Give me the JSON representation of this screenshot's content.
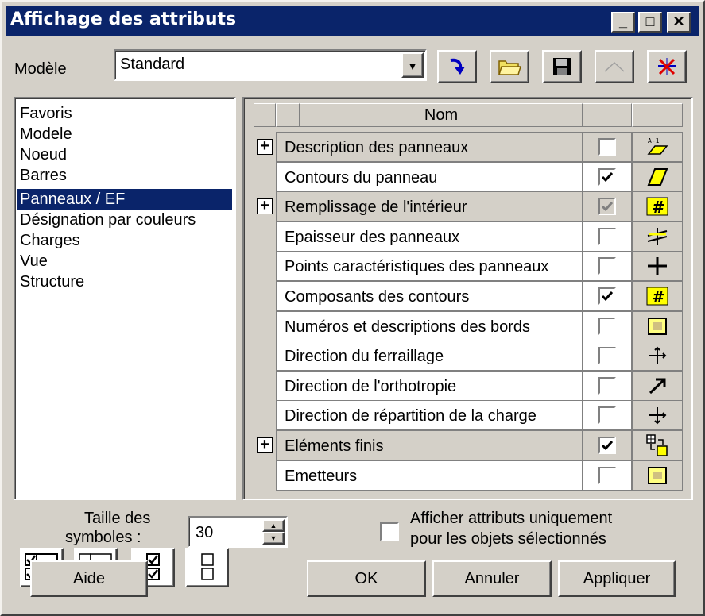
{
  "window": {
    "title": "Affichage des attributs"
  },
  "titlebar_buttons": {
    "minimize": "_",
    "maximize": "□",
    "close": "✕"
  },
  "model": {
    "label": "Modèle",
    "value": "Standard"
  },
  "toolbar": {
    "buttons": [
      "apply-arrow-icon",
      "open-folder-icon",
      "save-disk-icon",
      "disabled-chevron-icon",
      "delete-icon"
    ]
  },
  "categories": {
    "items": [
      "Favoris",
      "Modele",
      "Noeud",
      "Barres",
      "Panneaux / EF",
      "Désignation par couleurs",
      "Charges",
      "Vue",
      "Structure"
    ],
    "selected": "Panneaux / EF"
  },
  "grid": {
    "header": "Nom",
    "rows": [
      {
        "name": "Description des panneaux",
        "group": true,
        "checked": false,
        "disabled": false,
        "icon": "panel-label-icon"
      },
      {
        "name": "Contours du panneau",
        "group": false,
        "checked": true,
        "disabled": false,
        "icon": "panel-contour-icon"
      },
      {
        "name": "Remplissage de l'intérieur",
        "group": true,
        "checked": true,
        "disabled": true,
        "icon": "hatch-icon"
      },
      {
        "name": "Epaisseur des panneaux",
        "group": false,
        "checked": false,
        "disabled": false,
        "icon": "thickness-icon"
      },
      {
        "name": "Points caractéristiques des panneaux",
        "group": false,
        "checked": false,
        "disabled": false,
        "icon": "cross-point-icon"
      },
      {
        "name": "Composants des contours",
        "group": false,
        "checked": true,
        "disabled": false,
        "icon": "hatch-icon"
      },
      {
        "name": "Numéros et descriptions des bords",
        "group": false,
        "checked": false,
        "disabled": false,
        "icon": "edge-number-icon"
      },
      {
        "name": "Direction du ferraillage",
        "group": false,
        "checked": false,
        "disabled": false,
        "icon": "reinforcement-direction-icon"
      },
      {
        "name": "Direction de l'orthotropie",
        "group": false,
        "checked": false,
        "disabled": false,
        "icon": "diagonal-arrow-icon"
      },
      {
        "name": "Direction de répartition de la charge",
        "group": false,
        "checked": false,
        "disabled": false,
        "icon": "load-direction-icon"
      },
      {
        "name": "Eléments finis",
        "group": true,
        "checked": true,
        "disabled": false,
        "icon": "finite-element-icon"
      },
      {
        "name": "Emetteurs",
        "group": false,
        "checked": false,
        "disabled": false,
        "icon": "emitter-icon"
      }
    ]
  },
  "symbol_size": {
    "label_line1": "Taille des",
    "label_line2": "symboles :",
    "value": "30"
  },
  "selected_only": {
    "label_line1": "Afficher attributs uniquement",
    "label_line2": "pour les objets sélectionnés",
    "checked": false
  },
  "buttons": {
    "help": "Aide",
    "ok": "OK",
    "cancel": "Annuler",
    "apply": "Appliquer"
  },
  "colors": {
    "titlebar": "#0a246a",
    "face": "#d4d0c8",
    "selection": "#0a246a"
  }
}
